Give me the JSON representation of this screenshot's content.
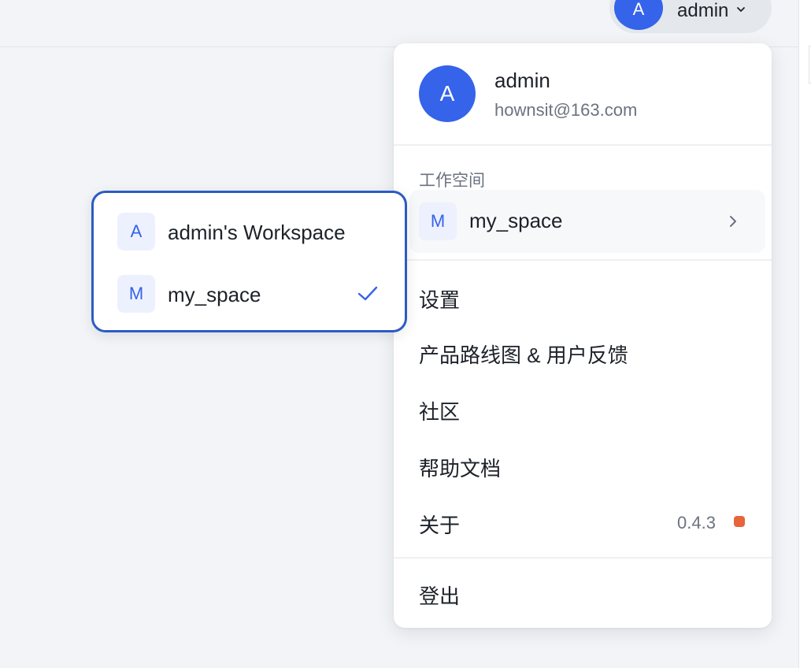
{
  "header": {
    "avatar_initial": "A",
    "username": "admin",
    "chevron_icon": "chevron-down-icon"
  },
  "menu": {
    "user": {
      "avatar_initial": "A",
      "name": "admin",
      "email": "hownsit@163.com"
    },
    "workspace_section_label": "工作空间",
    "current_workspace": {
      "initial": "M",
      "name": "my_space",
      "icon": "chevron-right-icon"
    },
    "items": [
      {
        "label": "设置"
      },
      {
        "label": "产品路线图 & 用户反馈"
      },
      {
        "label": "社区"
      },
      {
        "label": "帮助文档"
      },
      {
        "label": "关于"
      }
    ],
    "version": "0.4.3",
    "update_dot_color": "#e8643a",
    "logout_label": "登出"
  },
  "workspace_submenu": {
    "items": [
      {
        "initial": "A",
        "name": "admin's Workspace",
        "selected": false
      },
      {
        "initial": "M",
        "name": "my_space",
        "selected": true
      }
    ],
    "check_icon": "check-icon"
  },
  "colors": {
    "accent": "#3563e9",
    "submenu_border": "#2b5cc4",
    "page_background": "#f2f4f7"
  }
}
